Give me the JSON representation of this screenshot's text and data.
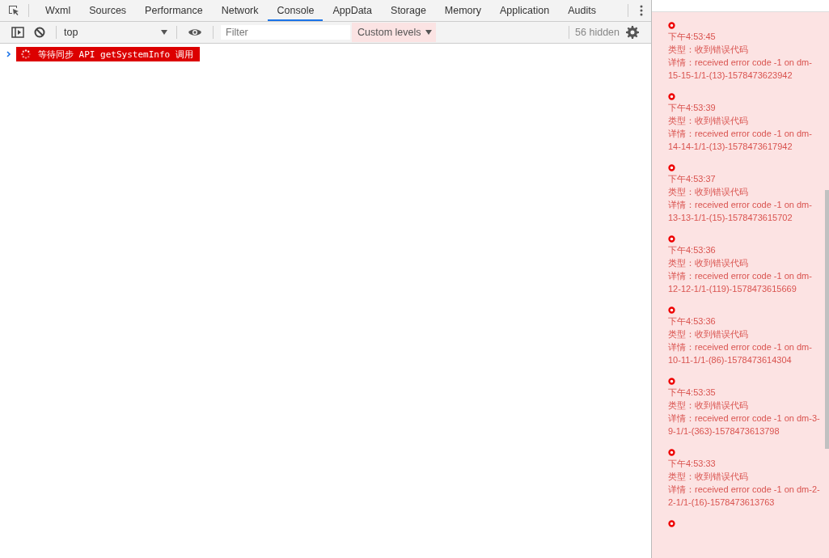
{
  "tabs": [
    {
      "label": "Wxml",
      "selected": false
    },
    {
      "label": "Sources",
      "selected": false
    },
    {
      "label": "Performance",
      "selected": false
    },
    {
      "label": "Network",
      "selected": false
    },
    {
      "label": "Console",
      "selected": true
    },
    {
      "label": "AppData",
      "selected": false
    },
    {
      "label": "Storage",
      "selected": false
    },
    {
      "label": "Memory",
      "selected": false
    },
    {
      "label": "Application",
      "selected": false
    },
    {
      "label": "Audits",
      "selected": false
    }
  ],
  "console_toolbar": {
    "context": "top",
    "filter": {
      "placeholder": "Filter"
    },
    "levels": "Custom levels",
    "hidden_count": "56 hidden"
  },
  "console_messages": [
    {
      "text": "等待同步 API getSystemInfo 调用",
      "kind": "pending"
    }
  ],
  "log_panel": {
    "entries": [
      {
        "time": "下午4:53:45",
        "type": "类型：收到错误代码",
        "detail": "详情：received error code -1 on dm-15-15-1/1-(13)-1578473623942"
      },
      {
        "time": "下午4:53:39",
        "type": "类型：收到错误代码",
        "detail": "详情：received error code -1 on dm-14-14-1/1-(13)-1578473617942"
      },
      {
        "time": "下午4:53:37",
        "type": "类型：收到错误代码",
        "detail": "详情：received error code -1 on dm-13-13-1/1-(15)-1578473615702"
      },
      {
        "time": "下午4:53:36",
        "type": "类型：收到错误代码",
        "detail": "详情：received error code -1 on dm-12-12-1/1-(119)-1578473615669"
      },
      {
        "time": "下午4:53:36",
        "type": "类型：收到错误代码",
        "detail": "详情：received error code -1 on dm-10-11-1/1-(86)-1578473614304"
      },
      {
        "time": "下午4:53:35",
        "type": "类型：收到错误代码",
        "detail": "详情：received error code -1 on dm-3-9-1/1-(363)-1578473613798"
      },
      {
        "time": "下午4:53:33",
        "type": "类型：收到错误代码",
        "detail": "详情：received error code -1 on dm-2-2-1/1-(16)-1578473613763"
      }
    ]
  }
}
